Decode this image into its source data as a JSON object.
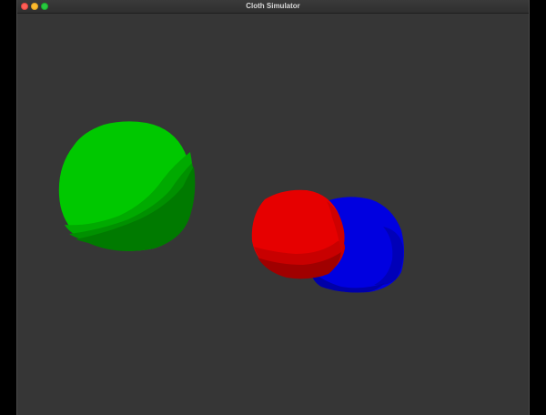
{
  "window": {
    "title": "Cloth Simulator"
  },
  "colors": {
    "background": "#363636",
    "green": "#00c800",
    "red": "#e60000",
    "blue": "#0000e0"
  },
  "scene": {
    "objects": [
      {
        "name": "green-ball",
        "color": "green"
      },
      {
        "name": "red-ball",
        "color": "red"
      },
      {
        "name": "blue-ball",
        "color": "blue"
      }
    ]
  }
}
